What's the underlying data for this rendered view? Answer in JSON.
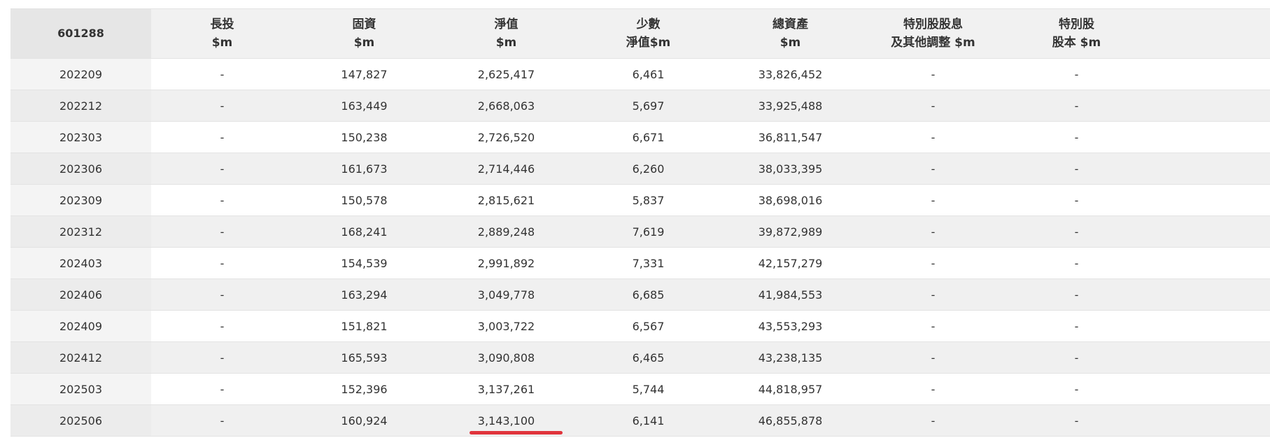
{
  "table": {
    "header": {
      "symbol": "601288",
      "columns": [
        {
          "line1": "長投",
          "line2": "$m"
        },
        {
          "line1": "固資",
          "line2": "$m"
        },
        {
          "line1": "淨值",
          "line2": "$m"
        },
        {
          "line1": "少數",
          "line2": "淨值$m"
        },
        {
          "line1": "總資產",
          "line2": "$m"
        },
        {
          "line1": "特別股股息",
          "line2": "及其他調整 $m"
        },
        {
          "line1": "特別股",
          "line2": "股本 $m"
        }
      ]
    },
    "rows": [
      {
        "period": "202209",
        "long_term_investment": "-",
        "fixed_assets": "147,827",
        "net_worth": "2,625,417",
        "minority_equity": "6,461",
        "total_assets": "33,826,452",
        "preferred_dividend_adj": "-",
        "preferred_capital": "-"
      },
      {
        "period": "202212",
        "long_term_investment": "-",
        "fixed_assets": "163,449",
        "net_worth": "2,668,063",
        "minority_equity": "5,697",
        "total_assets": "33,925,488",
        "preferred_dividend_adj": "-",
        "preferred_capital": "-"
      },
      {
        "period": "202303",
        "long_term_investment": "-",
        "fixed_assets": "150,238",
        "net_worth": "2,726,520",
        "minority_equity": "6,671",
        "total_assets": "36,811,547",
        "preferred_dividend_adj": "-",
        "preferred_capital": "-"
      },
      {
        "period": "202306",
        "long_term_investment": "-",
        "fixed_assets": "161,673",
        "net_worth": "2,714,446",
        "minority_equity": "6,260",
        "total_assets": "38,033,395",
        "preferred_dividend_adj": "-",
        "preferred_capital": "-"
      },
      {
        "period": "202309",
        "long_term_investment": "-",
        "fixed_assets": "150,578",
        "net_worth": "2,815,621",
        "minority_equity": "5,837",
        "total_assets": "38,698,016",
        "preferred_dividend_adj": "-",
        "preferred_capital": "-"
      },
      {
        "period": "202312",
        "long_term_investment": "-",
        "fixed_assets": "168,241",
        "net_worth": "2,889,248",
        "minority_equity": "7,619",
        "total_assets": "39,872,989",
        "preferred_dividend_adj": "-",
        "preferred_capital": "-"
      },
      {
        "period": "202403",
        "long_term_investment": "-",
        "fixed_assets": "154,539",
        "net_worth": "2,991,892",
        "minority_equity": "7,331",
        "total_assets": "42,157,279",
        "preferred_dividend_adj": "-",
        "preferred_capital": "-"
      },
      {
        "period": "202406",
        "long_term_investment": "-",
        "fixed_assets": "163,294",
        "net_worth": "3,049,778",
        "minority_equity": "6,685",
        "total_assets": "41,984,553",
        "preferred_dividend_adj": "-",
        "preferred_capital": "-"
      },
      {
        "period": "202409",
        "long_term_investment": "-",
        "fixed_assets": "151,821",
        "net_worth": "3,003,722",
        "minority_equity": "6,567",
        "total_assets": "43,553,293",
        "preferred_dividend_adj": "-",
        "preferred_capital": "-"
      },
      {
        "period": "202412",
        "long_term_investment": "-",
        "fixed_assets": "165,593",
        "net_worth": "3,090,808",
        "minority_equity": "6,465",
        "total_assets": "43,238,135",
        "preferred_dividend_adj": "-",
        "preferred_capital": "-"
      },
      {
        "period": "202503",
        "long_term_investment": "-",
        "fixed_assets": "152,396",
        "net_worth": "3,137,261",
        "minority_equity": "5,744",
        "total_assets": "44,818,957",
        "preferred_dividend_adj": "-",
        "preferred_capital": "-"
      },
      {
        "period": "202506",
        "long_term_investment": "-",
        "fixed_assets": "160,924",
        "net_worth": "3,143,100",
        "minority_equity": "6,141",
        "total_assets": "46,855,878",
        "preferred_dividend_adj": "-",
        "preferred_capital": "-"
      }
    ],
    "highlight": {
      "row": "202506",
      "column": "net_worth",
      "color": "#e0343c"
    }
  },
  "colors": {
    "header_bg": "#f1f1f1",
    "symbol_cell_bg": "#e6e6e6",
    "stripe_bg": "#f0f0f0",
    "text": "#333333",
    "border": "#e3e3e3"
  }
}
